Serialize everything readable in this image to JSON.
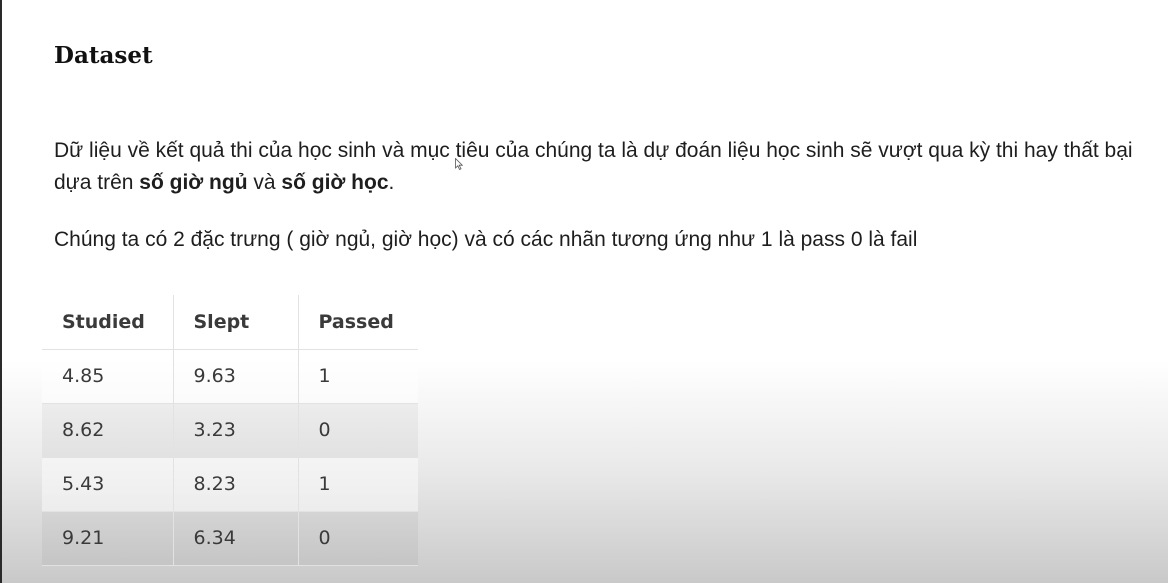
{
  "heading": "Dataset",
  "paragraph1": {
    "text_before": "Dữ liệu về kết quả thi của học sinh và mục tiêu của chúng ta là dự đoán liệu học sinh sẽ vượt qua kỳ thi hay thất bại dựa trên ",
    "bold1": "số giờ ngủ",
    "text_mid": " và ",
    "bold2": "số giờ học",
    "text_end": "."
  },
  "paragraph2": "Chúng ta có 2 đặc trưng ( giờ ngủ, giờ học) và có các nhãn tương ứng như 1 là pass 0 là fail",
  "table": {
    "headers": [
      "Studied",
      "Slept",
      "Passed"
    ],
    "rows": [
      [
        "4.85",
        "9.63",
        "1"
      ],
      [
        "8.62",
        "3.23",
        "0"
      ],
      [
        "5.43",
        "8.23",
        "1"
      ],
      [
        "9.21",
        "6.34",
        "0"
      ]
    ]
  },
  "icons": {
    "cursor": "mouse-cursor-icon"
  }
}
